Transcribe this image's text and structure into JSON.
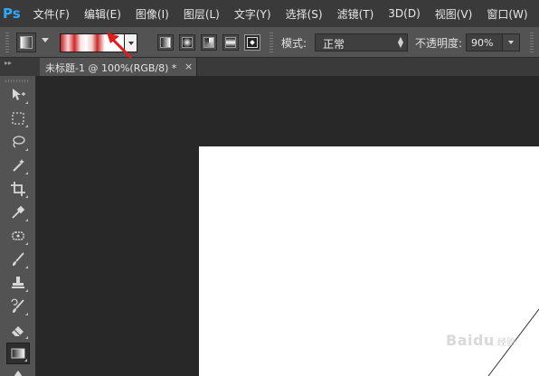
{
  "app": {
    "logo_text": "Ps"
  },
  "menu": [
    "文件(F)",
    "编辑(E)",
    "图像(I)",
    "图层(L)",
    "文字(Y)",
    "选择(S)",
    "滤镜(T)",
    "3D(D)",
    "视图(V)",
    "窗口(W)"
  ],
  "options": {
    "gradient_types": [
      "linear",
      "radial",
      "angle",
      "reflected",
      "diamond"
    ],
    "active_gradient_type": "diamond",
    "gradient_colors": [
      "#c41f22",
      "#ffffff"
    ],
    "mode_label": "模式:",
    "mode_value": "正常",
    "opacity_label": "不透明度:",
    "opacity_value": "90%"
  },
  "document_tab": {
    "title": "未标题-1 @ 100%(RGB/8) *",
    "close": "×"
  },
  "tools": [
    "move-tool",
    "marquee-tool",
    "lasso-tool",
    "magic-wand-tool",
    "crop-tool",
    "eyedropper-tool",
    "healing-brush-tool",
    "brush-tool",
    "clone-stamp-tool",
    "history-brush-tool",
    "eraser-tool",
    "gradient-tool",
    "blur-tool"
  ],
  "active_tool": "gradient-tool",
  "watermark": {
    "brand": "Baidu",
    "sub": "经验"
  },
  "colors": {
    "ui_dark": "#3a3a3a",
    "options_bg": "#535353",
    "canvas_bg": "#282828",
    "annotation_red": "#e31b1b",
    "ps_blue": "#31a8ff"
  }
}
